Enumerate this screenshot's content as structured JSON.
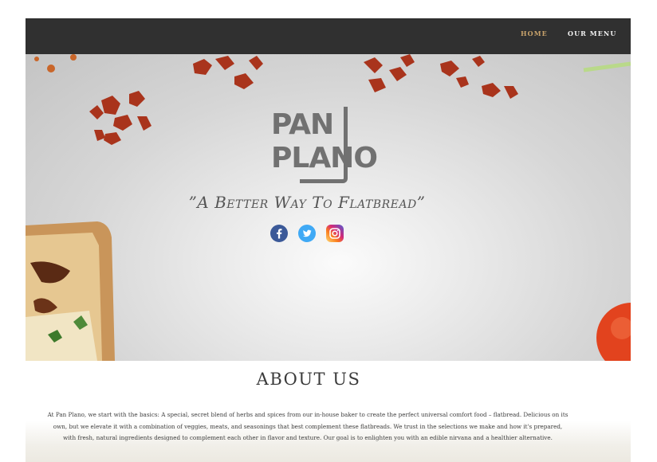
{
  "nav": {
    "home": "HOME",
    "menu": "OUR MENU"
  },
  "hero": {
    "logo_line1": "PAN",
    "logo_line2": "PLANO",
    "tagline": "”A Better Way To Flatbread”",
    "social": [
      "facebook-icon",
      "twitter-icon",
      "instagram-icon"
    ]
  },
  "about": {
    "title": "ABOUT US",
    "text": "At Pan Plano, we start with the basics:  A special, secret blend of herbs and spices from our in-house baker to create the perfect universal comfort food – flatbread. Delicious on its own, but we elevate it with a combination of veggies, meats, and seasonings that best complement these flatbreads. We trust in the selections we make and how it's prepared, with fresh, natural ingredients designed to complement each other in flavor and texture.  Our goal is to enlighten you with an edible nirvana and a healthier alternative."
  },
  "colors": {
    "navbar": "#303030",
    "active_link": "#c9a36b",
    "link": "#f2f2f2",
    "logo": "#717171"
  }
}
